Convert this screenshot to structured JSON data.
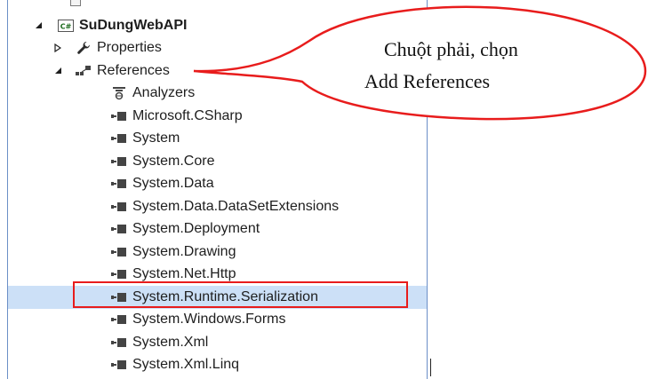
{
  "tree": [
    {
      "label": "SuDungWebAPI",
      "level": 0,
      "expander": "expanded",
      "icon": "csharp-project-icon",
      "bold": true
    },
    {
      "label": "Properties",
      "level": 1,
      "expander": "collapsed",
      "icon": "wrench-icon"
    },
    {
      "label": "References",
      "level": 1,
      "expander": "expanded",
      "icon": "references-icon"
    },
    {
      "label": "Analyzers",
      "level": 2,
      "icon": "analyzers-icon"
    },
    {
      "label": "Microsoft.CSharp",
      "level": 2,
      "icon": "assembly-reference-icon"
    },
    {
      "label": "System",
      "level": 2,
      "icon": "assembly-reference-icon"
    },
    {
      "label": "System.Core",
      "level": 2,
      "icon": "assembly-reference-icon"
    },
    {
      "label": "System.Data",
      "level": 2,
      "icon": "assembly-reference-icon"
    },
    {
      "label": "System.Data.DataSetExtensions",
      "level": 2,
      "icon": "assembly-reference-icon"
    },
    {
      "label": "System.Deployment",
      "level": 2,
      "icon": "assembly-reference-icon"
    },
    {
      "label": "System.Drawing",
      "level": 2,
      "icon": "assembly-reference-icon"
    },
    {
      "label": "System.Net.Http",
      "level": 2,
      "icon": "assembly-reference-icon"
    },
    {
      "label": "System.Runtime.Serialization",
      "level": 2,
      "icon": "assembly-reference-icon",
      "selected": true
    },
    {
      "label": "System.Windows.Forms",
      "level": 2,
      "icon": "assembly-reference-icon"
    },
    {
      "label": "System.Xml",
      "level": 2,
      "icon": "assembly-reference-icon"
    },
    {
      "label": "System.Xml.Linq",
      "level": 2,
      "icon": "assembly-reference-icon"
    }
  ],
  "callout": {
    "line1": "Chuột phải, chọn",
    "line2": "Add References",
    "color": "#e81c1c"
  },
  "colors": {
    "selection": "#cce0f7",
    "panel_border": "#6b8fc7",
    "annotation": "#e81c1c"
  }
}
